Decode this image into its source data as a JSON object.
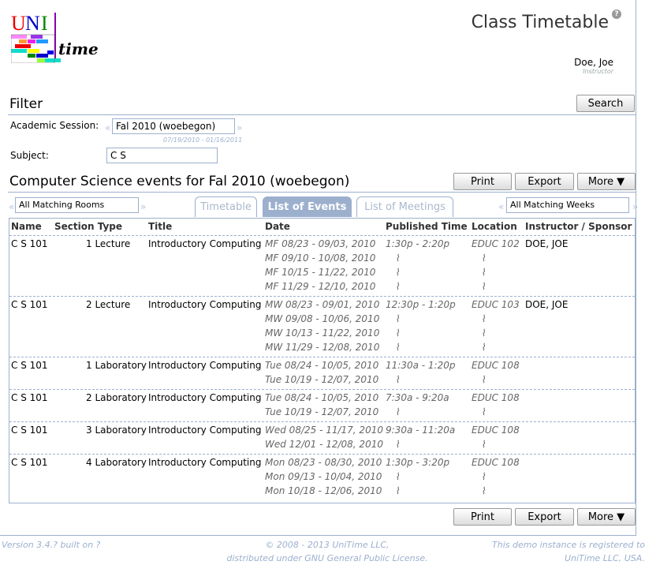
{
  "header": {
    "title": "Class Timetable",
    "help_icon": "help-icon",
    "user_name": "Doe, Joe",
    "user_role": "Instructor",
    "logo_text": "UNI time"
  },
  "filter": {
    "title": "Filter",
    "search_label": "Search",
    "session_label": "Academic Session:",
    "session_value": "Fal 2010 (woebegon)",
    "session_dates": "07/19/2010 - 01/16/2011",
    "subject_label": "Subject:",
    "subject_value": "C S"
  },
  "results": {
    "title": "Computer Science events for Fal 2010 (woebegon)",
    "print": "Print",
    "export": "Export",
    "more": "More ▼",
    "rooms_filter": "All Matching Rooms",
    "weeks_filter": "All Matching Weeks",
    "tabs": [
      {
        "label": "Timetable"
      },
      {
        "label": "List of Events"
      },
      {
        "label": "List of Meetings"
      }
    ],
    "columns": [
      "Name",
      "Section Type",
      "Title",
      "Date",
      "Published Time",
      "Location",
      "Instructor / Sponsor"
    ],
    "rows": [
      {
        "name": "C S 101",
        "type": "1 Lecture",
        "title": "Introductory Computing",
        "dates": [
          "MF 08/23 - 09/03, 2010",
          "MF 09/10 - 10/08, 2010",
          "MF 10/15 - 11/22, 2010",
          "MF 11/29 - 12/10, 2010"
        ],
        "time": "1:30p - 2:20p",
        "location": "EDUC 102",
        "instructor": "DOE, JOE"
      },
      {
        "name": "C S 101",
        "type": "2 Lecture",
        "title": "Introductory Computing",
        "dates": [
          "MW 08/23 - 09/01, 2010",
          "MW 09/08 - 10/06, 2010",
          "MW 10/13 - 11/22, 2010",
          "MW 11/29 - 12/08, 2010"
        ],
        "time": "12:30p - 1:20p",
        "location": "EDUC 103",
        "instructor": "DOE, JOE"
      },
      {
        "name": "C S 101",
        "type": "1 Laboratory",
        "title": "Introductory Computing",
        "dates": [
          "Tue 08/24 - 10/05, 2010",
          "Tue 10/19 - 12/07, 2010"
        ],
        "time": "11:30a - 1:20p",
        "location": "EDUC 108",
        "instructor": ""
      },
      {
        "name": "C S 101",
        "type": "2 Laboratory",
        "title": "Introductory Computing",
        "dates": [
          "Tue 08/24 - 10/05, 2010",
          "Tue 10/19 - 12/07, 2010"
        ],
        "time": "7:30a - 9:20a",
        "location": "EDUC 108",
        "instructor": ""
      },
      {
        "name": "C S 101",
        "type": "3 Laboratory",
        "title": "Introductory Computing",
        "dates": [
          "Wed 08/25 - 11/17, 2010",
          "Wed 12/01 - 12/08, 2010"
        ],
        "time": "9:30a - 11:20a",
        "location": "EDUC 108",
        "instructor": ""
      },
      {
        "name": "C S 101",
        "type": "4 Laboratory",
        "title": "Introductory Computing",
        "dates": [
          "Mon 08/23 - 08/30, 2010",
          "Mon 09/13 - 10/04, 2010",
          "Mon 10/18 - 12/06, 2010"
        ],
        "time": "1:30p - 3:20p",
        "location": "EDUC 108",
        "instructor": ""
      }
    ]
  },
  "footer": {
    "version": "Version 3.4.? built on ?",
    "copyright_1": "© 2008 - 2013 UniTime LLC,",
    "copyright_2": "distributed under GNU General Public License.",
    "registered_1": "This demo instance is registered to",
    "registered_2": "UniTime LLC, USA."
  }
}
